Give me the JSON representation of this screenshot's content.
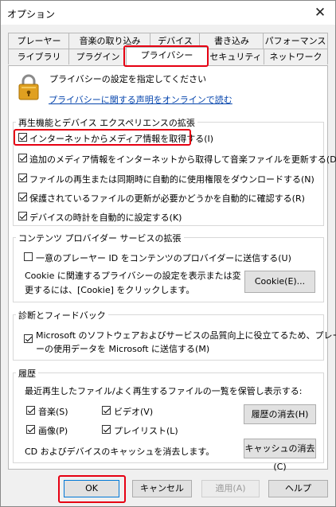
{
  "window": {
    "title": "オプション",
    "close_glyph": "✕"
  },
  "tabs_row1": [
    {
      "label": "プレーヤー"
    },
    {
      "label": "音楽の取り込み"
    },
    {
      "label": "デバイス"
    },
    {
      "label": "書き込み"
    },
    {
      "label": "パフォーマンス"
    }
  ],
  "tabs_row2": [
    {
      "label": "ライブラリ"
    },
    {
      "label": "プラグイン"
    },
    {
      "label": "プライバシー",
      "active": true
    },
    {
      "label": "セキュリティ"
    },
    {
      "label": "ネットワーク"
    }
  ],
  "header": {
    "description": "プライバシーの設定を指定してください",
    "link": "プライバシーに関する声明をオンラインで読む"
  },
  "playback_group": {
    "title": "再生機能とデバイス エクスペリエンスの拡張",
    "options": [
      {
        "label": "インターネットからメディア情報を取得する(I)",
        "checked": true
      },
      {
        "label": "追加のメディア情報をインターネットから取得して音楽ファイルを更新する(D)",
        "checked": true
      },
      {
        "label": "ファイルの再生または同期時に自動的に使用権限をダウンロードする(N)",
        "checked": true
      },
      {
        "label": "保護されているファイルの更新が必要かどうかを自動的に確認する(R)",
        "checked": true
      },
      {
        "label": "デバイスの時計を自動的に設定する(K)",
        "checked": true
      }
    ]
  },
  "content_group": {
    "title": "コンテンツ プロバイダー サービスの拡張",
    "option": {
      "label": "一意のプレーヤー ID をコンテンツのプロバイダーに送信する(U)",
      "checked": false
    },
    "cookie_text_line1": "Cookie に関連するプライバシーの設定を表示または変",
    "cookie_text_line2": "更するには、[Cookie] をクリックします。",
    "cookie_button": "Cookie(E)..."
  },
  "diagnostics_group": {
    "title": "診断とフィードバック",
    "option_line1": "Microsoft のソフトウェアおよびサービスの品質向上に役立てるため、プレーヤ",
    "option_line2": "ーの使用データを Microsoft に送信する(M)",
    "checked": true
  },
  "history_group": {
    "title": "履歴",
    "description": "最近再生したファイル/よく再生するファイルの一覧を保管し表示する:",
    "options": [
      {
        "label": "音楽(S)",
        "checked": true
      },
      {
        "label": "ビデオ(V)",
        "checked": true
      },
      {
        "label": "画像(P)",
        "checked": true
      },
      {
        "label": "プレイリスト(L)",
        "checked": true
      }
    ],
    "clear_history_button": "履歴の消去(H)",
    "cache_text": "CD およびデバイスのキャッシュを消去します。",
    "clear_cache_button": "キャッシュの消去(C)"
  },
  "footer": {
    "ok": "OK",
    "cancel": "キャンセル",
    "apply": "適用(A)",
    "help": "ヘルプ"
  },
  "colors": {
    "highlight": "#e60012",
    "link": "#0645ad",
    "accent": "#0078d7"
  }
}
